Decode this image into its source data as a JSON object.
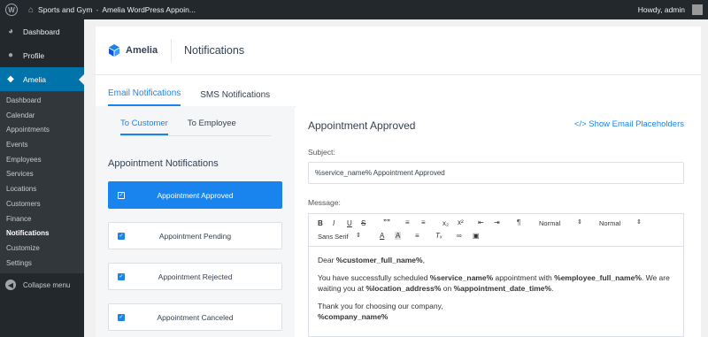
{
  "adminbar": {
    "site_title": "Sports and Gym",
    "page_title": "Amelia WordPress Appoin...",
    "howdy": "Howdy, admin"
  },
  "sidebar": {
    "top_items": [
      {
        "label": "Dashboard",
        "icon": "speedometer-icon"
      },
      {
        "label": "Profile",
        "icon": "user-icon"
      }
    ],
    "active_item": {
      "label": "Amelia",
      "icon": "amelia-icon"
    },
    "submenu": [
      "Dashboard",
      "Calendar",
      "Appointments",
      "Events",
      "Employees",
      "Services",
      "Locations",
      "Customers",
      "Finance",
      "Notifications",
      "Customize",
      "Settings"
    ],
    "current_submenu": "Notifications",
    "collapse_label": "Collapse menu"
  },
  "header": {
    "brand_name": "Amelia",
    "page_title": "Notifications"
  },
  "tabs": [
    {
      "label": "Email Notifications",
      "active": true
    },
    {
      "label": "SMS Notifications",
      "active": false
    }
  ],
  "subtabs": [
    {
      "label": "To Customer",
      "active": true
    },
    {
      "label": "To Employee",
      "active": false
    }
  ],
  "notifications": {
    "heading": "Appointment Notifications",
    "items": [
      {
        "label": "Appointment Approved",
        "selected": true
      },
      {
        "label": "Appointment Pending",
        "selected": false
      },
      {
        "label": "Appointment Rejected",
        "selected": false
      },
      {
        "label": "Appointment Canceled",
        "selected": false
      }
    ]
  },
  "detail": {
    "title": "Appointment Approved",
    "placeholders_link": "</> Show Email Placeholders",
    "subject_label": "Subject:",
    "subject_value": "%service_name% Appointment Approved",
    "message_label": "Message:",
    "toolbar": {
      "bold": "B",
      "italic": "I",
      "underline": "U",
      "strike": "S",
      "quote": "””",
      "sub": "x₂",
      "sup": "x²",
      "direction": "¶",
      "heading_select": "Normal",
      "size_select": "Normal",
      "font_select": "Sans Serif"
    },
    "message": {
      "p1_prefix": "Dear ",
      "customer_full_name": "%customer_full_name%",
      "p1_suffix": ",",
      "p2_a": "You have successfully scheduled ",
      "service_name": "%service_name%",
      "p2_b": " appointment with ",
      "employee_full_name": "%employee_full_name%",
      "p2_c": ". We are waiting you at ",
      "location_address": "%location_address%",
      "p2_d": " on ",
      "appointment_date_time": "%appointment_date_time%",
      "p2_e": ".",
      "p3": "Thank you for choosing our company,",
      "company_name": "%company_name%"
    }
  },
  "colors": {
    "wp_dark": "#23282d",
    "wp_blue": "#0073aa",
    "amelia_blue": "#1a84ee",
    "panel_gray": "#f4f6f8"
  }
}
